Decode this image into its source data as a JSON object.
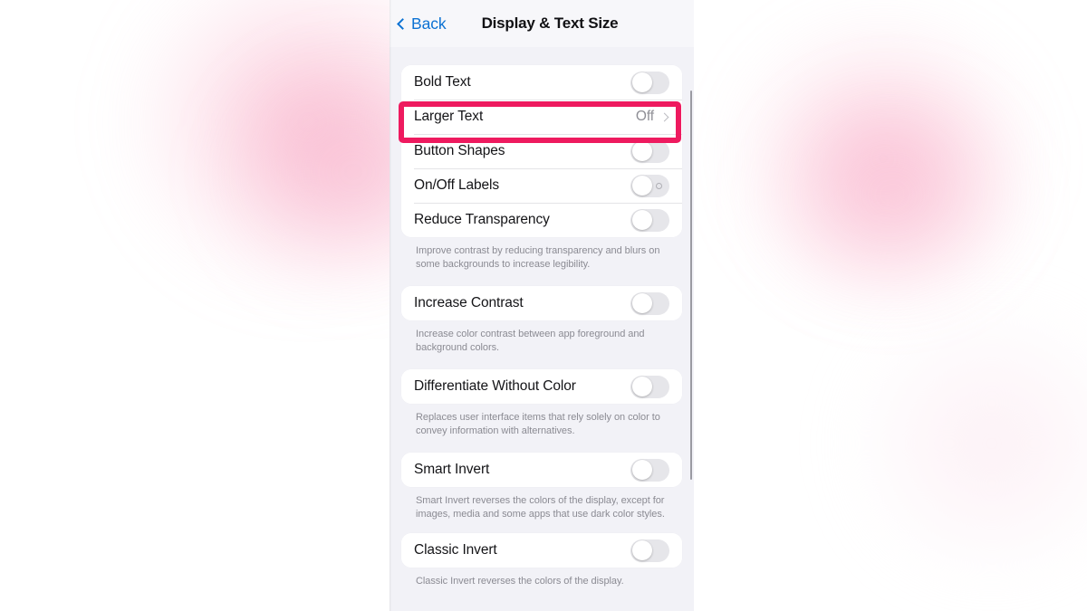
{
  "nav": {
    "back_label": "Back",
    "title": "Display & Text Size",
    "back_icon": "chevron-left-icon"
  },
  "colors": {
    "accent_blue": "#0c72d3",
    "highlight_pink": "#ee1a5f",
    "panel_bg": "#f2f2f7",
    "row_bg": "#ffffff",
    "note_text": "#8b8b93"
  },
  "groups": [
    {
      "id": "text-group",
      "rows": [
        {
          "label": "Bold Text",
          "control": "switch",
          "state": "off"
        },
        {
          "label": "Larger Text",
          "control": "disclosure",
          "value": "Off",
          "highlighted": true
        },
        {
          "label": "Button Shapes",
          "control": "switch",
          "state": "off"
        },
        {
          "label": "On/Off Labels",
          "control": "switch",
          "state": "off",
          "off_mark": true
        },
        {
          "label": "Reduce Transparency",
          "control": "switch",
          "state": "off"
        }
      ],
      "note": "Improve contrast by reducing transparency and blurs on some backgrounds to increase legibility."
    },
    {
      "id": "increase-contrast-group",
      "rows": [
        {
          "label": "Increase Contrast",
          "control": "switch",
          "state": "off"
        }
      ],
      "note": "Increase color contrast between app foreground and background colors."
    },
    {
      "id": "differentiate-group",
      "rows": [
        {
          "label": "Differentiate Without Color",
          "control": "switch",
          "state": "off"
        }
      ],
      "note": "Replaces user interface items that rely solely on color to convey information with alternatives."
    },
    {
      "id": "smart-invert-group",
      "rows": [
        {
          "label": "Smart Invert",
          "control": "switch",
          "state": "off"
        }
      ],
      "note": "Smart Invert reverses the colors of the display, except for images, media and some apps that use dark color styles."
    },
    {
      "id": "classic-invert-group",
      "rows": [
        {
          "label": "Classic Invert",
          "control": "switch",
          "state": "off"
        }
      ],
      "note": "Classic Invert reverses the colors of the display."
    }
  ]
}
